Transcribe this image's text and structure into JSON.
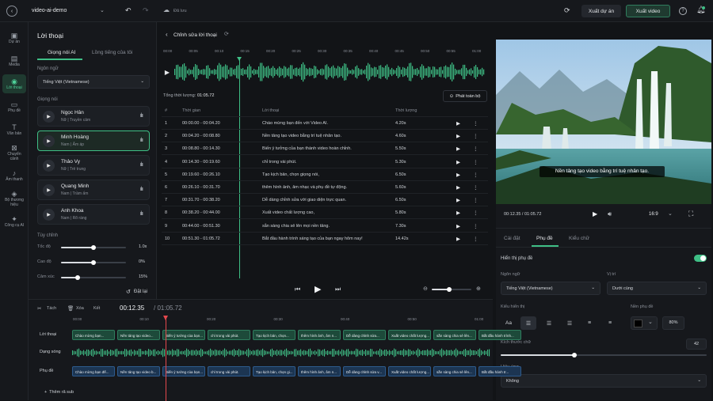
{
  "colors": {
    "accent": "#3fbf86",
    "bg": "#121417",
    "panel": "#16181c",
    "playhead": "#e5484d"
  },
  "topbar": {
    "back_icon": "circle-arrow-left-icon",
    "project": "video-ai-demo",
    "undo_icon": "undo-icon",
    "redo_icon": "redo-icon",
    "saved": "Đã lưu",
    "export_project": "Xuất dự án",
    "export_video": "Xuất video",
    "help_icon": "question-icon",
    "bell_icon": "bell-icon",
    "sync_icon": "sync-icon"
  },
  "rail": [
    {
      "label": "Dự án",
      "icon": "folder-icon",
      "glyph": "▣"
    },
    {
      "label": "Media",
      "icon": "media-icon",
      "glyph": "▤"
    },
    {
      "label": "Lời thoại",
      "icon": "speech-icon",
      "glyph": "◉",
      "active": true
    },
    {
      "label": "Phụ đề",
      "icon": "subtitle-icon",
      "glyph": "▭"
    },
    {
      "label": "Văn bản",
      "icon": "text-icon",
      "glyph": "T"
    },
    {
      "label": "Chuyển cảnh",
      "icon": "transition-icon",
      "glyph": "⊠"
    },
    {
      "label": "Âm thanh",
      "icon": "music-icon",
      "glyph": "♪"
    },
    {
      "label": "Bộ thương hiệu",
      "icon": "brand-icon",
      "glyph": "◈"
    },
    {
      "label": "Công cụ AI",
      "icon": "ai-tools-icon",
      "glyph": "✦"
    }
  ],
  "left": {
    "title": "Lời thoại",
    "tabs": [
      "Giọng nói AI",
      "Lồng tiếng của tôi"
    ],
    "language_label": "Ngôn ngữ",
    "language_value": "Tiếng Việt (Vietnamese)",
    "voice_label": "Giọng nói",
    "voices": [
      {
        "name": "Ngọc Hân",
        "desc": "Nữ | Truyền cảm"
      },
      {
        "name": "Minh Hoàng",
        "desc": "Nam | Ấm áp",
        "selected": true
      },
      {
        "name": "Thảo Vy",
        "desc": "Nữ | Trẻ trung"
      },
      {
        "name": "Quang Minh",
        "desc": "Nam | Trầm ấm"
      },
      {
        "name": "Anh Khoa",
        "desc": "Nam | Rõ ràng"
      }
    ],
    "adjust_label": "Tùy chỉnh",
    "sliders": [
      {
        "label": "Tốc độ",
        "value": "1.0x",
        "level": 0.5
      },
      {
        "label": "Cao độ",
        "value": "0%",
        "level": 0.5
      },
      {
        "label": "Cảm xúc",
        "value": "15%",
        "level": 0.25
      }
    ],
    "reset": "Đặt lại"
  },
  "center": {
    "title": "Chỉnh sửa lời thoại",
    "ruler": [
      "00:00",
      "00:05",
      "00:10",
      "00:15",
      "00:20",
      "00:25",
      "00:30",
      "00:35",
      "00:40",
      "00:45",
      "00:50",
      "00:55",
      "01:00"
    ],
    "total_label": "Tổng thời lượng:",
    "total_value": "01:05.72",
    "play_all": "Phát toàn bộ",
    "headers": [
      "#",
      "Thời gian",
      "Lời thoại",
      "Thời lượng"
    ],
    "rows": [
      {
        "n": "1",
        "time": "00:00.00 - 00:04.20",
        "text": "Chào mừng bạn đến với Video AI.",
        "dur": "4.20s"
      },
      {
        "n": "2",
        "time": "00:04.20 - 00:08.80",
        "text": "Nền tảng tạo video bằng trí tuệ nhân tạo.",
        "dur": "4.60s"
      },
      {
        "n": "3",
        "time": "00:08.80 - 00:14.30",
        "text": "Biến ý tưởng của bạn thành video hoàn chỉnh.",
        "dur": "5.50s"
      },
      {
        "n": "4",
        "time": "00:14.30 - 00:19.60",
        "text": "chỉ trong vài phút.",
        "dur": "5.30s"
      },
      {
        "n": "5",
        "time": "00:19.60 - 00:26.10",
        "text": "Tạo kịch bản, chọn giọng nói,",
        "dur": "6.50s"
      },
      {
        "n": "6",
        "time": "00:26.10 - 00:31.70",
        "text": "thêm hình ảnh, âm nhạc và phụ đề tự động.",
        "dur": "5.60s"
      },
      {
        "n": "7",
        "time": "00:31.70 - 00:38.20",
        "text": "Dễ dàng chỉnh sửa với giao diện trực quan.",
        "dur": "6.50s"
      },
      {
        "n": "8",
        "time": "00:38.20 - 00:44.00",
        "text": "Xuất video chất lượng cao,",
        "dur": "5.80s"
      },
      {
        "n": "9",
        "time": "00:44.00 - 00:51.30",
        "text": "sẵn sàng chia sẻ lên mọi nền tảng.",
        "dur": "7.30s"
      },
      {
        "n": "10",
        "time": "00:51.30 - 01:05.72",
        "text": "Bắt đầu hành trình sáng tạo của bạn ngay hôm nay!",
        "dur": "14.42s"
      }
    ],
    "volume": 0.6
  },
  "timeline": {
    "tools": [
      "Tách",
      "Xóa",
      "Kết"
    ],
    "current": "00:12.35",
    "total": "/ 01:05.72",
    "ticks": [
      "00:00",
      "00:10",
      "00:20",
      "00:30",
      "00:40",
      "00:50",
      "01:00"
    ],
    "tracks": [
      "Lời thoại",
      "Dạng sóng",
      "Phụ đề"
    ],
    "voice_clips": [
      "Chào mừng bạn...",
      "Nền tảng tạo video...",
      "Biến ý tưởng của bạn...",
      "chỉ trong vài phút.",
      "Tạo kịch bản, chọn...",
      "thêm hình ảnh, âm n...",
      "Dễ dàng chỉnh sửa...",
      "Xuất video chất lượng...",
      "sẵn sàng chia sẻ lên...",
      "Bắt đầu hành trình..."
    ],
    "sub_clips": [
      "Chào mừng bạn đế...",
      "Nền tảng tạo video b...",
      "Biến ý tưởng của bạn...",
      "chỉ trong vài phút.",
      "Tạo kịch bản, chọn gi...",
      "thêm hình ảnh, âm n...",
      "Dễ dàng chỉnh sửa v...",
      "Xuất video chất lượng...",
      "sẵn sàng chia sẻ lên...",
      "Bắt đầu hành tr..."
    ],
    "add_sub": "Thêm rã sub"
  },
  "right": {
    "caption": "Nền tảng tạo video bằng trí tuệ nhân tạo.",
    "time": "00:12.35 / 01:05.72",
    "ratio": "16:9",
    "tabs": [
      "Cài đặt",
      "Phụ đề",
      "Kiểu chữ"
    ],
    "show_sub": "Hiển thị phụ đề",
    "lang_label": "Ngôn ngữ",
    "lang_value": "Tiếng Việt (Vietnamese)",
    "pos_label": "Vị trí",
    "pos_value": "Dưới cùng",
    "style_label": "Kiểu hiển thị",
    "bg_label": "Nền phụ đề",
    "opacity": "80%",
    "size_label": "Kích thước chữ",
    "size_value": "42",
    "effect_label": "Hiệu ứng",
    "effect_value": "Không"
  }
}
